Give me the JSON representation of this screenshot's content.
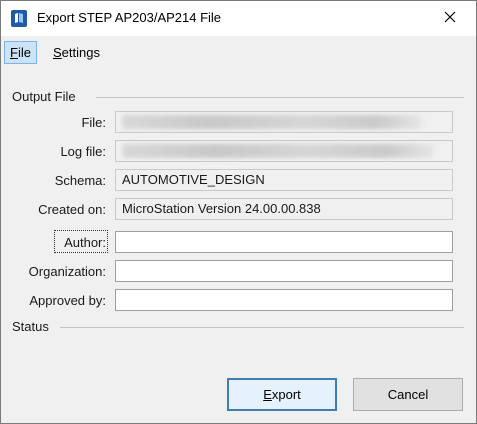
{
  "window": {
    "title": "Export STEP AP203/AP214 File",
    "app_icon": "microstation-icon",
    "close_icon": "close-icon"
  },
  "tabs": [
    {
      "label": "File",
      "mnemonic_index": 0,
      "active": true
    },
    {
      "label": "Settings",
      "mnemonic_index": 0,
      "active": false
    }
  ],
  "output_file": {
    "heading": "Output File",
    "file": {
      "label": "File:",
      "value": ""
    },
    "log_file": {
      "label": "Log file:",
      "value": ""
    },
    "schema": {
      "label": "Schema:",
      "value": "AUTOMOTIVE_DESIGN"
    },
    "created_on": {
      "label": "Created on:",
      "value": "MicroStation Version 24.00.00.838"
    },
    "author": {
      "label": "Author:",
      "value": ""
    },
    "organization": {
      "label": "Organization:",
      "value": ""
    },
    "approved_by": {
      "label": "Approved by:",
      "value": ""
    }
  },
  "status": {
    "heading": "Status"
  },
  "buttons": {
    "export": {
      "label": "Export",
      "mnemonic_index": 0
    },
    "cancel": {
      "label": "Cancel"
    }
  },
  "colors": {
    "accent": "#3c7fb1",
    "active_tab_bg": "#cce4f7",
    "dialog_bg": "#f0f0f0"
  }
}
